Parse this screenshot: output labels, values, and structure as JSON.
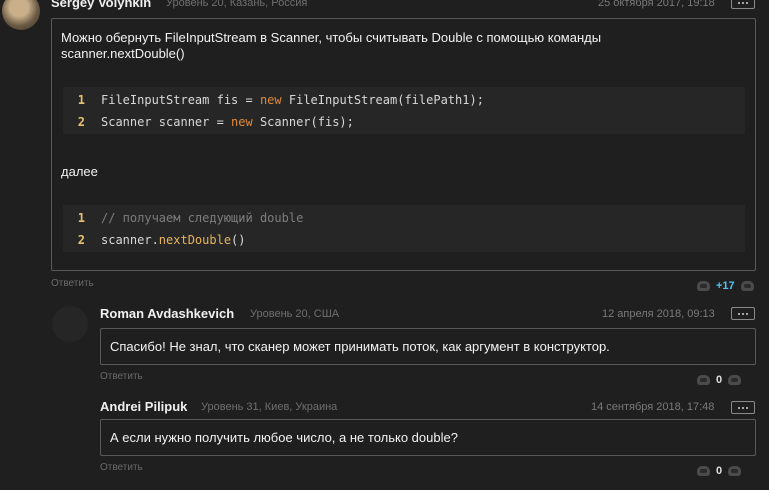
{
  "comment": {
    "author": "Sergey Volynkin",
    "meta": "Уровень 20, Казань, Россия",
    "date": "25 октября 2017, 19:18",
    "text_intro": "Можно обернуть FileInputStream в Scanner, чтобы считывать Double с помощью команды scanner.nextDouble()",
    "code1": [
      {
        "num": "1",
        "parts": [
          {
            "t": "FileInputStream fis = ",
            "c": "plain"
          },
          {
            "t": "new",
            "c": "kw"
          },
          {
            "t": " FileInputStream(filePath1);",
            "c": "plain"
          }
        ]
      },
      {
        "num": "2",
        "parts": [
          {
            "t": "Scanner scanner = ",
            "c": "plain"
          },
          {
            "t": "new",
            "c": "kw"
          },
          {
            "t": " Scanner(fis);",
            "c": "plain"
          }
        ]
      }
    ],
    "text_mid": "далее",
    "code2": [
      {
        "num": "1",
        "parts": [
          {
            "t": "// получаем следующий double",
            "c": "cm"
          }
        ]
      },
      {
        "num": "2",
        "parts": [
          {
            "t": "scanner.",
            "c": "plain"
          },
          {
            "t": "nextDouble",
            "c": "fn"
          },
          {
            "t": "()",
            "c": "plain"
          }
        ]
      }
    ],
    "reply_label": "Ответить",
    "votes": "+17"
  },
  "replies": [
    {
      "author": "Roman Avdashkevich",
      "meta": "Уровень 20, США",
      "date": "12 апреля 2018, 09:13",
      "text": "Спасибо! Не знал, что сканер может принимать поток, как аргумент в конструктор.",
      "reply_label": "Ответить",
      "votes": "0"
    },
    {
      "author": "Andrei Pilipuk",
      "meta": "Уровень 31, Киев, Украина",
      "date": "14 сентября 2018, 17:48",
      "text": "А если нужно получить любое число, а не только double?",
      "reply_label": "Ответить",
      "votes": "0"
    }
  ],
  "colors": {
    "accent_positive": "#4fc3f7",
    "line_number": "#e8c070",
    "keyword": "#e08a3c",
    "method": "#e6b35a"
  },
  "icons": {
    "more": "more-options-icon",
    "vote": "vote-arrow-icon"
  }
}
